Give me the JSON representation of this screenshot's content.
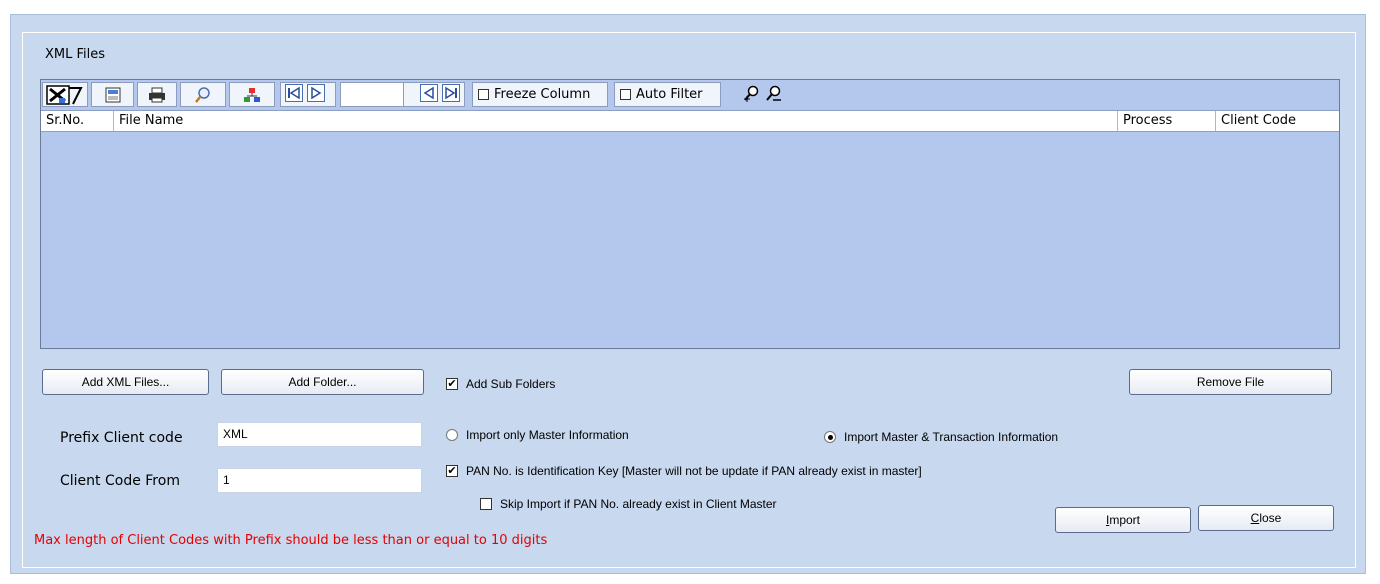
{
  "group": {
    "title": "XML Files"
  },
  "toolbar": {
    "icons": [
      "excel-export-icon",
      "report-icon",
      "print-icon",
      "find-icon",
      "tree-icon",
      "first-record-icon",
      "prev-record-icon",
      "next-record-icon",
      "last-record-icon"
    ],
    "freeze_column_label": "Freeze Column",
    "auto_filter_label": "Auto Filter",
    "freeze_column_checked": false,
    "auto_filter_checked": false
  },
  "grid": {
    "columns": [
      "Sr.No.",
      "File Name",
      "Process",
      "Client Code"
    ],
    "rows": []
  },
  "buttons": {
    "add_xml_files": "Add XML Files...",
    "add_folder": "Add Folder...",
    "remove_file": "Remove File",
    "import_prefix": "I",
    "import_rest": "mport",
    "close_prefix": "C",
    "close_rest": "lose"
  },
  "options": {
    "add_sub_folders": {
      "label": "Add Sub Folders",
      "checked": true
    },
    "import_only_master": {
      "label": "Import only Master Information",
      "selected": false
    },
    "import_master_transaction": {
      "label": "Import Master & Transaction Information",
      "selected": true
    },
    "pan_identification_key": {
      "label": "PAN No. is Identification Key [Master will not be update if PAN already exist in master]",
      "checked": true
    },
    "skip_import_pan": {
      "label": "Skip Import if PAN No. already exist in Client Master",
      "checked": false
    }
  },
  "fields": {
    "prefix_client_code": {
      "label": "Prefix Client code",
      "value": "XML"
    },
    "client_code_from": {
      "label": "Client Code From",
      "value": "1"
    }
  },
  "warning": "Max length of Client Codes with Prefix should be less than or equal to 10 digits",
  "colors": {
    "panel": "#c7d8ef",
    "grid": "#b3c8ec",
    "warning": "#e60000"
  }
}
